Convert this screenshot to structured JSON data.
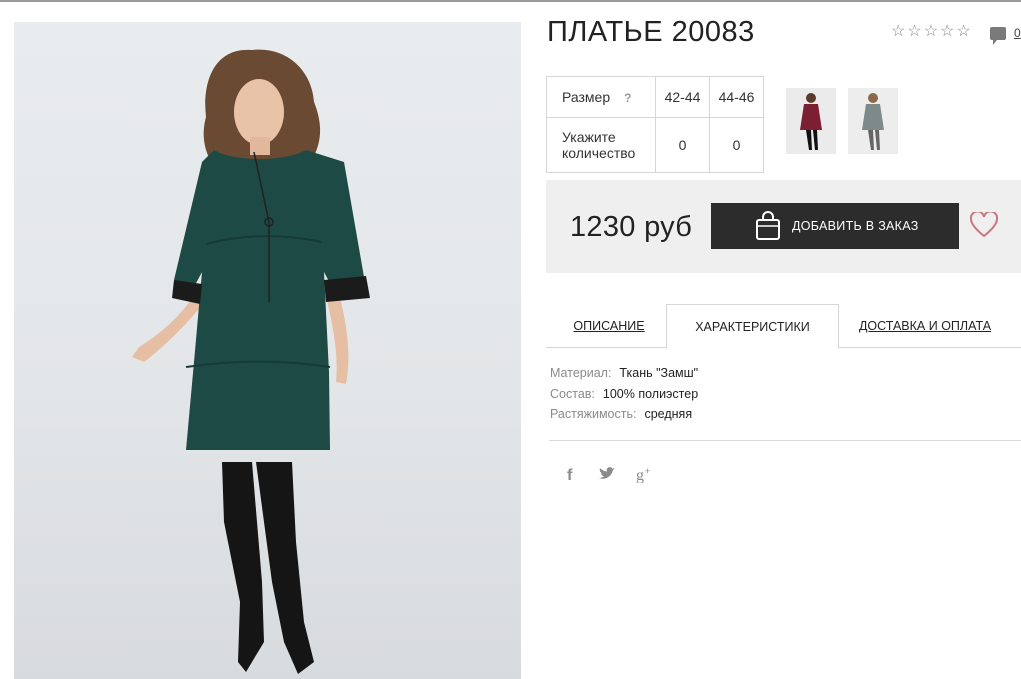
{
  "product": {
    "title": "ПЛАТЬЕ 20083",
    "rating_stars": 5,
    "rating_filled": 0,
    "comment_count": "0",
    "main_photo_alt": "",
    "colors": {
      "dress": "#1e4a45",
      "boots": "#151515",
      "accent": "#c9777f"
    }
  },
  "size_table": {
    "size_label": "Размер",
    "help_mark": "?",
    "sizes": [
      "42-44",
      "44-46"
    ],
    "qty_label_line1": "Укажите",
    "qty_label_line2": "количество",
    "quantities": [
      "0",
      "0"
    ]
  },
  "thumbnails": [
    {
      "name": "thumb-burgundy",
      "color": "#7c1f32"
    },
    {
      "name": "thumb-grey",
      "color": "#7d8a89"
    }
  ],
  "purchase": {
    "price": "1230 руб",
    "add_button_label": "ДОБАВИТЬ В ЗАКАЗ",
    "button_icon": "shopping-bag-icon",
    "wishlist_icon": "heart-icon"
  },
  "tabs": [
    {
      "label": "ОПИСАНИЕ",
      "active": false
    },
    {
      "label": "ХАРАКТЕРИСТИКИ",
      "active": true
    },
    {
      "label": "ДОСТАВКА И ОПЛАТА",
      "active": false
    }
  ],
  "specs": [
    {
      "key": "Материал:",
      "value": "Ткань \"Замш\""
    },
    {
      "key": "Состав:",
      "value": "100% полиэстер"
    },
    {
      "key": "Растяжимость:",
      "value": "средняя"
    }
  ],
  "social": {
    "facebook_glyph": "f",
    "twitter_icon": "twitter-icon",
    "gplus_glyph": "g+"
  }
}
